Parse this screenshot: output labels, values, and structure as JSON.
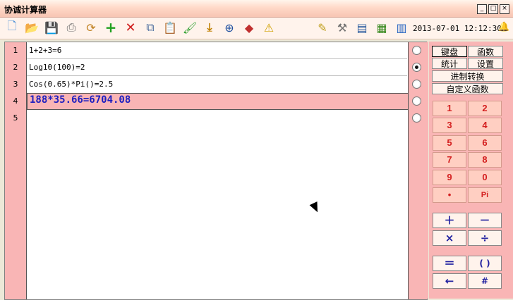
{
  "window": {
    "title": "协诚计算器",
    "min": "_",
    "max": "□",
    "close": "×"
  },
  "toolbar": {
    "icons": [
      "new-file-icon",
      "open-folder-icon",
      "save-icon",
      "print-icon",
      "refresh-icon",
      "add-icon",
      "delete-icon",
      "copy-icon",
      "paste-icon",
      "brush-icon",
      "download-icon",
      "add-page-icon",
      "eraser-icon",
      "warning-icon",
      "pencil-icon",
      "tools-icon",
      "notepad-icon",
      "chip-icon",
      "calendar-icon"
    ],
    "datetime": "2013-07-01  12:12:30"
  },
  "lines": [
    {
      "num": "1",
      "expr": "1+2+3=6",
      "checked": false
    },
    {
      "num": "2",
      "expr": "Log10(100)=2",
      "checked": true
    },
    {
      "num": "3",
      "expr": "Cos(0.65)*Pi()=2.5",
      "checked": false
    },
    {
      "num": "4",
      "expr": "188*35.66=6704.08",
      "checked": false
    },
    {
      "num": "5",
      "expr": "",
      "checked": false
    }
  ],
  "panel": {
    "tab_keyboard": "键盘",
    "tab_functions": "函数",
    "tab_stats": "统计",
    "tab_settings": "设置",
    "base_convert": "进制转换",
    "custom_functions": "自定义函数",
    "keys": [
      "1",
      "2",
      "3",
      "4",
      "5",
      "6",
      "7",
      "8",
      "9",
      "0",
      "•",
      "Pi"
    ],
    "ops": [
      "＋",
      "－",
      "×",
      "÷",
      "＝",
      "( )",
      "←",
      "#"
    ]
  }
}
